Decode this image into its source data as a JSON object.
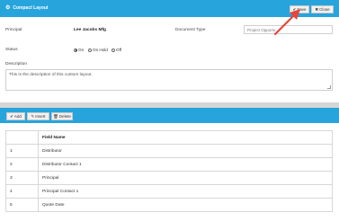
{
  "header": {
    "icon": "gear-icon",
    "title": "Compact Layout",
    "save_label": "Save",
    "close_label": "Close",
    "accent_color": "#27a4dc"
  },
  "form": {
    "principal_label": "Principal",
    "principal_value": "Lee Jacobs Mfg",
    "document_type_label": "Document Type",
    "document_type_value": "Project Opportu",
    "status_label": "Status",
    "status_options": [
      {
        "label": "On",
        "selected": true
      },
      {
        "label": "On Hold",
        "selected": false
      },
      {
        "label": "Off",
        "selected": false
      }
    ],
    "description_label": "Description",
    "description_value": "This is the description of this custom layout."
  },
  "toolbar": {
    "add_label": "Add",
    "insert_label": "Insert",
    "delete_label": "Delete"
  },
  "grid": {
    "columns": [
      "",
      "Field Name"
    ],
    "rows": [
      {
        "num": "1",
        "field": "Distributor"
      },
      {
        "num": "2",
        "field": "Distributor Contact 1"
      },
      {
        "num": "3",
        "field": "Principal"
      },
      {
        "num": "4",
        "field": "Principal Contact 1"
      },
      {
        "num": "5",
        "field": "Quote Date"
      }
    ]
  },
  "annotation": {
    "arrow_color": "#e8453c"
  }
}
